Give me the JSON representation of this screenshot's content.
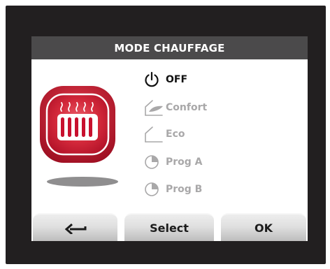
{
  "title": "MODE CHAUFFAGE",
  "menu": {
    "items": [
      {
        "label": "OFF",
        "icon": "power-icon",
        "state": "active"
      },
      {
        "label": "Confort",
        "icon": "comfort-feather-icon",
        "state": "inactive"
      },
      {
        "label": "Eco",
        "icon": "eco-moon-icon",
        "state": "inactive"
      },
      {
        "label": "Prog A",
        "icon": "prog-clock-icon",
        "state": "inactive"
      },
      {
        "label": "Prog B",
        "icon": "prog-clock-icon",
        "state": "inactive"
      }
    ]
  },
  "softkeys": {
    "back_icon": "back-arrow-icon",
    "select_label": "Select",
    "ok_label": "OK"
  },
  "colors": {
    "bezel": "#221f20",
    "title_bar": "#4b4a4b",
    "accent_red": "#c8102e",
    "active_text": "#111111",
    "inactive_text": "#a9a8a9"
  }
}
